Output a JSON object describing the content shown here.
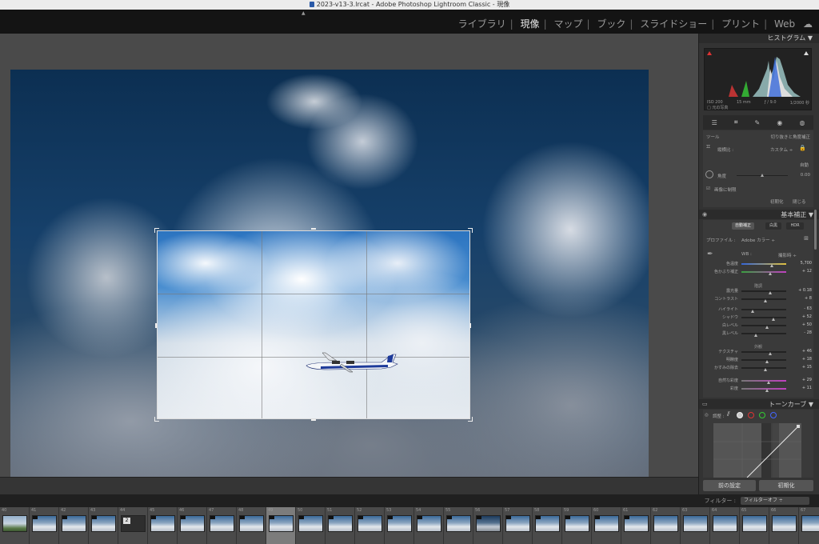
{
  "window": {
    "title": "2023-v13-3.lrcat - Adobe Photoshop Lightroom Classic - 現像"
  },
  "modules": [
    {
      "label": "ライブラリ",
      "active": false
    },
    {
      "label": "現像",
      "active": true
    },
    {
      "label": "マップ",
      "active": false
    },
    {
      "label": "ブック",
      "active": false
    },
    {
      "label": "スライドショー",
      "active": false
    },
    {
      "label": "プリント",
      "active": false
    },
    {
      "label": "Web",
      "active": false
    }
  ],
  "histogram": {
    "title": "ヒストグラム",
    "iso": "ISO 200",
    "focal": "15 mm",
    "aperture": "ƒ / 9.0",
    "shutter": "1/2000 秒",
    "original_label": "元の写真"
  },
  "crop_panel": {
    "tool_label": "ツール",
    "mode_label": "切り抜きと角度補正",
    "aspect_label": "縦横比 :",
    "aspect_value": "カスタム ÷",
    "auto_label": "自動",
    "angle_label": "角度",
    "angle_value": "0.00",
    "constrain_label": "画像に制限",
    "reset_label": "初期化",
    "close_label": "閉じる"
  },
  "basic": {
    "title": "基本補正",
    "tabs": [
      "自動補正",
      "白黒",
      "HDR"
    ],
    "profile_label": "プロファイル :",
    "profile_value": "Adobe カラー ÷",
    "wb_label": "WB :",
    "wb_value": "撮影時 ÷",
    "tone_group": "階調",
    "presence_group": "外観",
    "sliders": [
      {
        "label": "色温度",
        "value": "5,700"
      },
      {
        "label": "色かぶり補正",
        "value": "+ 12"
      },
      {
        "label": "露光量",
        "value": "+ 0.18"
      },
      {
        "label": "コントラスト",
        "value": "+ 8"
      },
      {
        "label": "ハイライト",
        "value": "- 63"
      },
      {
        "label": "シャドウ",
        "value": "+ 52"
      },
      {
        "label": "白レベル",
        "value": "+ 50"
      },
      {
        "label": "黒レベル",
        "value": "- 28"
      },
      {
        "label": "テクスチャ",
        "value": "+ 46"
      },
      {
        "label": "明瞭度",
        "value": "+ 18"
      },
      {
        "label": "かすみの除去",
        "value": "+ 15"
      },
      {
        "label": "自然な彩度",
        "value": "+ 29"
      },
      {
        "label": "彩度",
        "value": "+ 11"
      }
    ]
  },
  "tone_curve": {
    "title": "トーンカーブ",
    "adjust_label": "調整 :"
  },
  "panel_buttons": {
    "previous": "前の設定",
    "reset": "初期化"
  },
  "filmstrip": {
    "filter_label": "フィルター :",
    "filter_value": "フィルターオフ",
    "thumbs": [
      "40",
      "41",
      "42",
      "43",
      "44",
      "45",
      "46",
      "47",
      "48",
      "49",
      "50",
      "51",
      "52",
      "53",
      "54",
      "55",
      "56",
      "57",
      "58",
      "59",
      "60",
      "61",
      "62",
      "63",
      "64",
      "65",
      "66",
      "67",
      "68"
    ],
    "selected_index": 9,
    "stack_badge": "2"
  },
  "colors": {
    "accent_active": "#e8e8e8",
    "panel_bg": "#333333",
    "main_bg": "#4a4a4a"
  }
}
